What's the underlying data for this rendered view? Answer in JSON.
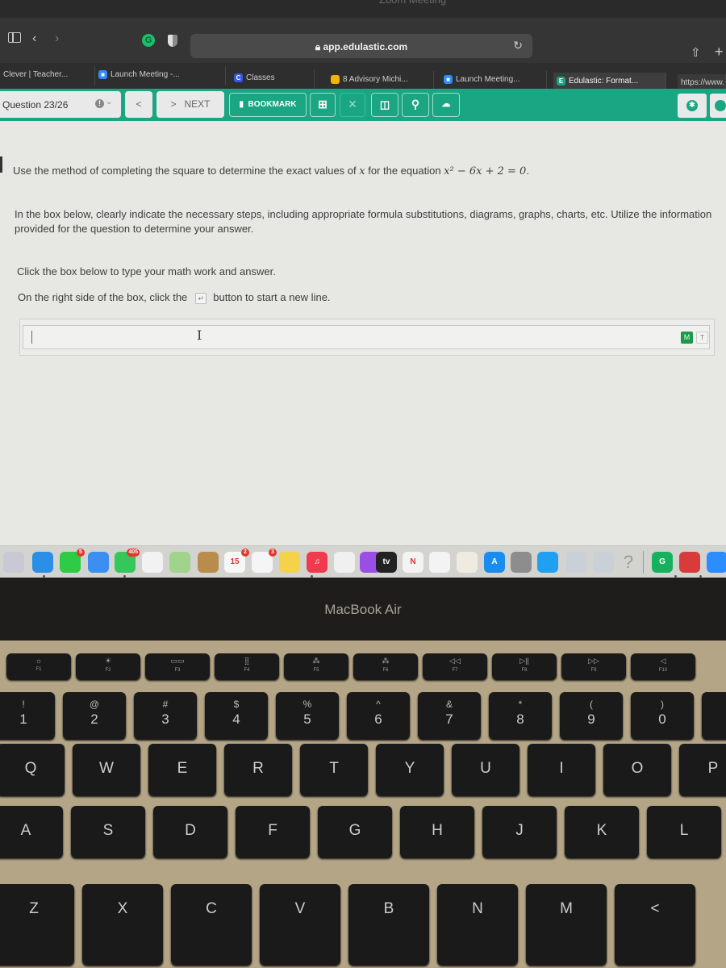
{
  "window": {
    "overlay_title": "Zoom Meeting"
  },
  "browser": {
    "url": "app.edulastic.com",
    "icons": [
      "sidebar-icon",
      "back-icon",
      "forward-icon",
      "grammarly-icon",
      "privacy-shield-icon",
      "lock-icon",
      "reload-icon",
      "share-icon",
      "new-tab-icon"
    ],
    "tabs": [
      {
        "label": "Clever | Teacher...",
        "favicon": ""
      },
      {
        "label": "Launch Meeting -...",
        "favicon": "zoom",
        "color": "#2d8cff"
      },
      {
        "label": "Classes",
        "favicon": "C",
        "color": "#3558e6"
      },
      {
        "label": "8 Advisory Michi...",
        "favicon": "classroom",
        "color": "#f3b400"
      },
      {
        "label": "Launch Meeting...",
        "favicon": "zoom",
        "color": "#2d8cff"
      },
      {
        "label": "Edulastic: Format...",
        "favicon": "E",
        "color": "#1aa583",
        "active": true
      },
      {
        "label": "https://www.",
        "favicon": ""
      }
    ]
  },
  "assessment_bar": {
    "question_counter": "Question 23/26",
    "prev_label": "<",
    "next_label": "NEXT",
    "next_chevron": ">",
    "bookmark_label": "BOOKMARK",
    "tools": [
      "grid-icon",
      "close-icon",
      "scratchpad-icon",
      "magnifier-icon",
      "upload-icon"
    ],
    "right_tools": [
      "accessibility-icon",
      "settings-icon"
    ],
    "accent_color": "#1aa583"
  },
  "question": {
    "prompt_prefix": "Use the method of completing the square to determine the exact values of ",
    "prompt_var": "x",
    "prompt_mid": " for the equation ",
    "equation": "x² − 6x + 2 = 0",
    "prompt_end": ".",
    "instructions": "In the box below, clearly indicate the necessary steps, including appropriate formula substitutions, diagrams, graphs, charts, etc. Utilize the information provided for the question to determine your answer.",
    "click_hint": "Click the box below to type your math work and answer.",
    "newline_hint_before": "On the right side of the box, click the",
    "newline_icon": "↵",
    "newline_hint_after": "button to start a new line.",
    "answer_value": "",
    "mode_math": "M",
    "mode_text": "T"
  },
  "dock": {
    "apps": [
      {
        "name": "launchpad",
        "color": "#c9c9d6"
      },
      {
        "name": "safari",
        "color": "#2b8fe8"
      },
      {
        "name": "facetime",
        "color": "#2ecc46",
        "badge": "5"
      },
      {
        "name": "mail",
        "color": "#3b8ff0"
      },
      {
        "name": "messages",
        "color": "#35c759",
        "badge": "405"
      },
      {
        "name": "photos",
        "color": "#f2f2f2"
      },
      {
        "name": "maps",
        "color": "#9fd48a"
      },
      {
        "name": "contacts",
        "color": "#b98c4e"
      },
      {
        "name": "calendar",
        "color": "#f7f7f7",
        "badge": "2",
        "text": "15"
      },
      {
        "name": "reminders",
        "color": "#f5f5f5",
        "badge": "3"
      },
      {
        "name": "notes",
        "color": "#f4d24a"
      },
      {
        "name": "music",
        "color": "#f23a4f",
        "text": "♫"
      },
      {
        "name": "keynote",
        "color": "#f0f0f0"
      },
      {
        "name": "podcasts",
        "color": "#9b4ee6"
      },
      {
        "name": "apple-tv",
        "color": "#222222",
        "text": "tv"
      },
      {
        "name": "news",
        "color": "#f3f3f3",
        "text": "N"
      },
      {
        "name": "numbers",
        "color": "#f3f3f3"
      },
      {
        "name": "pages",
        "color": "#f0ebe0"
      },
      {
        "name": "app-store",
        "color": "#1a8cf0",
        "text": "A"
      },
      {
        "name": "system-preferences",
        "color": "#8d8d8d"
      },
      {
        "name": "screens",
        "color": "#1fa0f0"
      },
      {
        "name": "roblox",
        "color": "#c9d0d8"
      },
      {
        "name": "roblox-studio",
        "color": "#c9d0d8"
      },
      {
        "name": "help",
        "color": "transparent",
        "text": "?"
      },
      {
        "name": "grammarly",
        "color": "#16b15f",
        "text": "G"
      },
      {
        "name": "photo-booth",
        "color": "#d93a3a"
      },
      {
        "name": "zoom",
        "color": "#2d8cff"
      }
    ]
  },
  "device": {
    "label": "MacBook Air"
  },
  "keyboard": {
    "fkeys": [
      {
        "sym": "☼",
        "label": "F1"
      },
      {
        "sym": "☀",
        "label": "F2"
      },
      {
        "sym": "▭▭",
        "label": "F3"
      },
      {
        "sym": "⣿",
        "label": "F4"
      },
      {
        "sym": "⁂",
        "label": "F5"
      },
      {
        "sym": "⁂",
        "label": "F6"
      },
      {
        "sym": "◁◁",
        "label": "F7"
      },
      {
        "sym": "▷||",
        "label": "F8"
      },
      {
        "sym": "▷▷",
        "label": "F9"
      },
      {
        "sym": "◁",
        "label": "F10"
      }
    ],
    "numbers": [
      {
        "top": "!",
        "bot": "1"
      },
      {
        "top": "@",
        "bot": "2"
      },
      {
        "top": "#",
        "bot": "3"
      },
      {
        "top": "$",
        "bot": "4"
      },
      {
        "top": "%",
        "bot": "5"
      },
      {
        "top": "^",
        "bot": "6"
      },
      {
        "top": "&",
        "bot": "7"
      },
      {
        "top": "*",
        "bot": "8"
      },
      {
        "top": "(",
        "bot": "9"
      },
      {
        "top": ")",
        "bot": "0"
      },
      {
        "top": "—",
        "bot": "-"
      }
    ],
    "row_q": [
      "Q",
      "W",
      "E",
      "R",
      "T",
      "Y",
      "U",
      "I",
      "O",
      "P"
    ],
    "row_a": [
      "A",
      "S",
      "D",
      "F",
      "G",
      "H",
      "J",
      "K",
      "L"
    ],
    "row_z": [
      "Z",
      "X",
      "C",
      "V",
      "B",
      "N",
      "M",
      "<"
    ]
  }
}
